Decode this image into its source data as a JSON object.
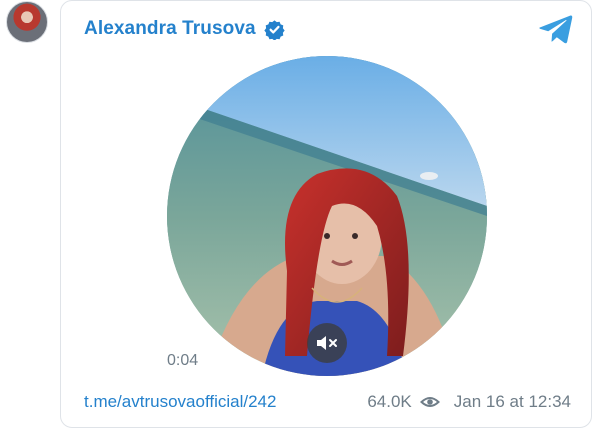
{
  "post": {
    "author": "Alexandra Trusova",
    "verified_icon": "verified-badge-icon",
    "channel_icon": "telegram-icon",
    "video_duration": "0:04",
    "mute_icon": "muted-speaker-icon",
    "link": "t.me/avtrusovaofficial/242",
    "views": "64.0K",
    "views_icon": "eye-icon",
    "date": "Jan 16 at 12:34"
  },
  "colors": {
    "accent": "#2481cc",
    "muted_text": "#6f7d88",
    "card_border": "#dfe3e8"
  }
}
